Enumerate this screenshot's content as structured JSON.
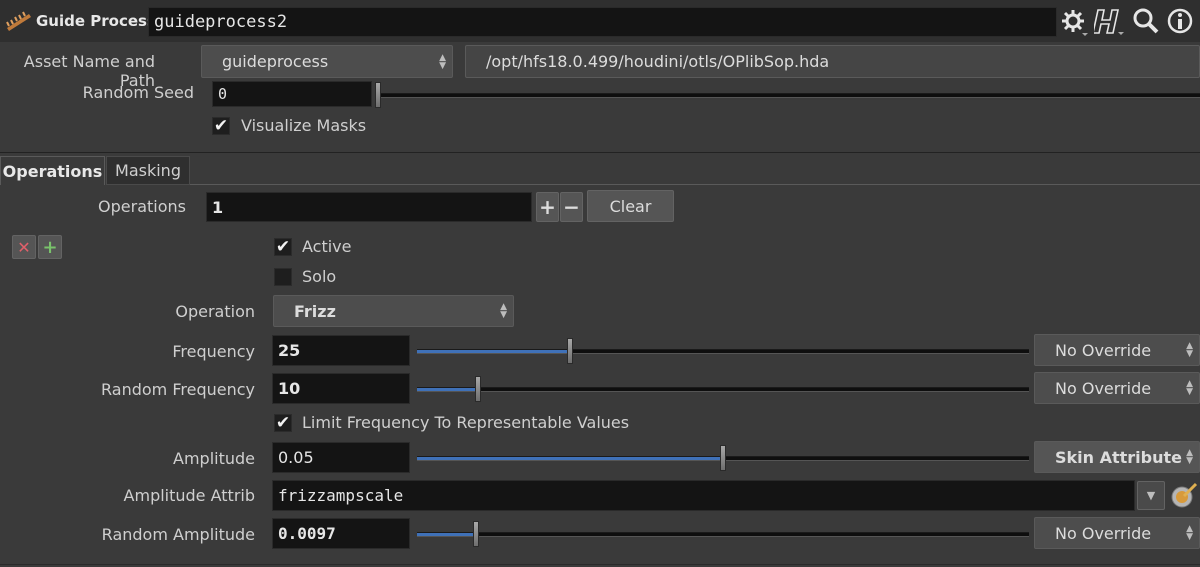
{
  "header": {
    "node_type": "Guide Process",
    "node_name": "guideprocess2",
    "icons": [
      "gear-icon",
      "houdini-h-icon",
      "magnifier-icon",
      "info-icon"
    ]
  },
  "asset": {
    "label": "Asset Name and Path",
    "name": "guideprocess",
    "path": "/opt/hfs18.0.499/houdini/otls/OPlibSop.hda"
  },
  "random_seed": {
    "label": "Random Seed",
    "value": "0",
    "slider_fraction": 0.0
  },
  "visualize_masks": {
    "label": "Visualize Masks",
    "checked": true
  },
  "tabs": [
    {
      "label": "Operations",
      "active": true
    },
    {
      "label": "Masking",
      "active": false
    }
  ],
  "operations": {
    "label": "Operations",
    "count": "1",
    "plus": "+",
    "minus": "−",
    "clear_label": "Clear"
  },
  "op": {
    "active": {
      "label": "Active",
      "checked": true
    },
    "solo": {
      "label": "Solo",
      "checked": false
    },
    "operation": {
      "label": "Operation",
      "value": "Frizz"
    },
    "frequency": {
      "label": "Frequency",
      "value": "25",
      "slider_fraction": 0.25,
      "override": "No Override"
    },
    "random_frequency": {
      "label": "Random Frequency",
      "value": "10",
      "slider_fraction": 0.1,
      "override": "No Override"
    },
    "limit_frequency": {
      "label": "Limit Frequency To Representable Values",
      "checked": true
    },
    "amplitude": {
      "label": "Amplitude",
      "value": "0.05",
      "slider_fraction": 0.5,
      "override": "Skin Attribute"
    },
    "amplitude_attrib": {
      "label": "Amplitude Attrib",
      "value": "frizzampscale"
    },
    "random_amplitude": {
      "label": "Random Amplitude",
      "value": "0.0097",
      "slider_fraction": 0.097,
      "override": "No Override"
    }
  },
  "colors": {
    "background": "#3a3a3a",
    "field": "#141414",
    "slider_fill": "#3f71b8",
    "remove_icon": "#c8505a",
    "add_icon": "#79c26b"
  }
}
